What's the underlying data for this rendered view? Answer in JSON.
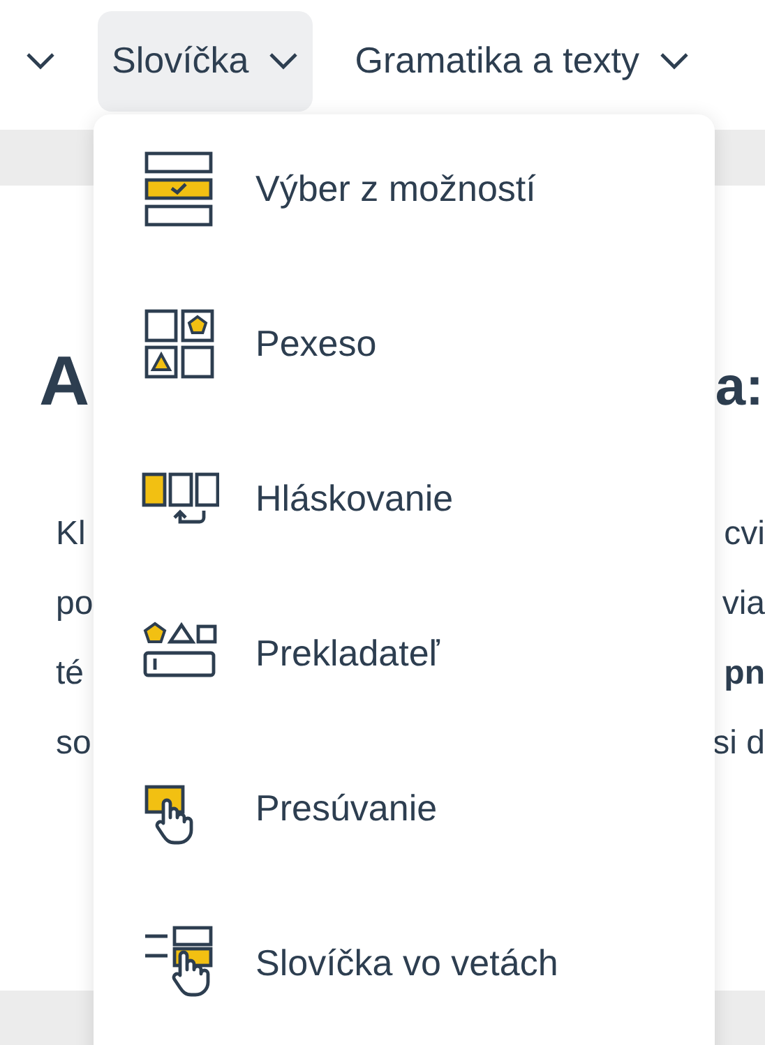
{
  "nav": [
    {
      "expanded": false
    },
    {
      "label": "Slovíčka",
      "expanded": true
    },
    {
      "label": "Gramatika a texty",
      "expanded": false
    }
  ],
  "page": {
    "heading": {
      "left": "A",
      "right": "a:"
    },
    "lines": [
      {
        "left": "Kl",
        "right": "cvi",
        "emphasis": false
      },
      {
        "left": "po",
        "right": "via",
        "emphasis": false
      },
      {
        "left": "té",
        "right": "pn",
        "emphasis": true
      },
      {
        "left": "so",
        "right": "si d",
        "emphasis": false
      }
    ]
  },
  "menu": [
    {
      "label": "Výber z možností",
      "kind": "choice"
    },
    {
      "label": "Pexeso",
      "kind": "pairs"
    },
    {
      "label": "Hláskovanie",
      "kind": "spelling"
    },
    {
      "label": "Prekladateľ",
      "kind": "translator"
    },
    {
      "label": "Presúvanie",
      "kind": "drag"
    },
    {
      "label": "Slovíčka vo vetách",
      "kind": "sentences"
    }
  ]
}
